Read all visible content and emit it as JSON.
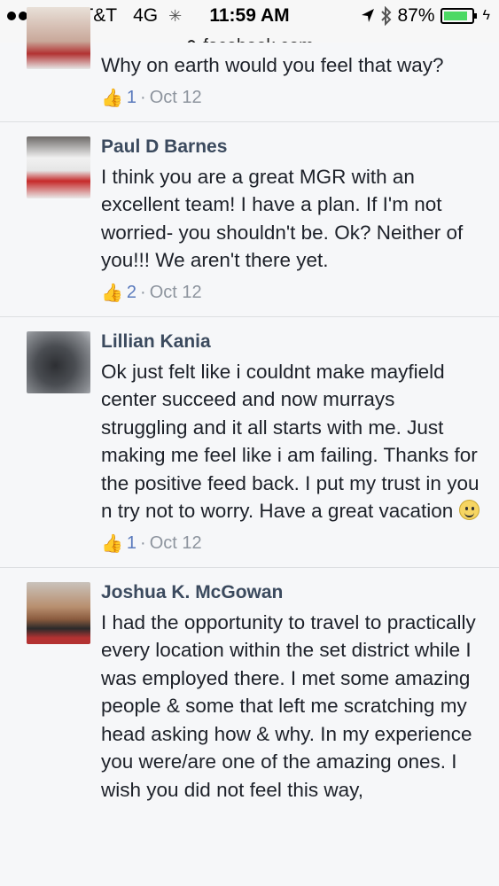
{
  "status": {
    "carrier": "AT&T",
    "network": "4G",
    "time": "11:59 AM",
    "battery": "87%",
    "battery_level": 0.87
  },
  "browser": {
    "url": "facebook.com"
  },
  "comments": [
    {
      "name": "",
      "text": "Why on earth would you feel that way?",
      "likes": "1",
      "date": "Oct 12"
    },
    {
      "name": "Paul D Barnes",
      "text": "I think you are a great MGR with an excellent team! I have a plan. If I'm not worried- you shouldn't be. Ok? Neither of you!!! We aren't there yet.",
      "likes": "2",
      "date": "Oct 12"
    },
    {
      "name": "Lillian Kania",
      "text": "Ok just felt like i couldnt make mayfield center succeed and now murrays struggling and it all starts with me. Just making me feel like i am failing. Thanks for the positive feed back. I put my trust in you n try not to worry. Have a great vacation",
      "likes": "1",
      "date": "Oct 12"
    },
    {
      "name": "Joshua K. McGowan",
      "text": "I had the opportunity to travel to practically every location within the set district while I was employed there. I met some amazing people & some that left me scratching my head asking how & why. In my experience you were/are one of the amazing ones. I wish you did not feel this way,"
    }
  ],
  "separator": "·",
  "icons": {
    "like": "thumbs-up-icon",
    "lock": "lock-icon",
    "location": "location-arrow-icon",
    "bluetooth": "bluetooth-icon"
  }
}
